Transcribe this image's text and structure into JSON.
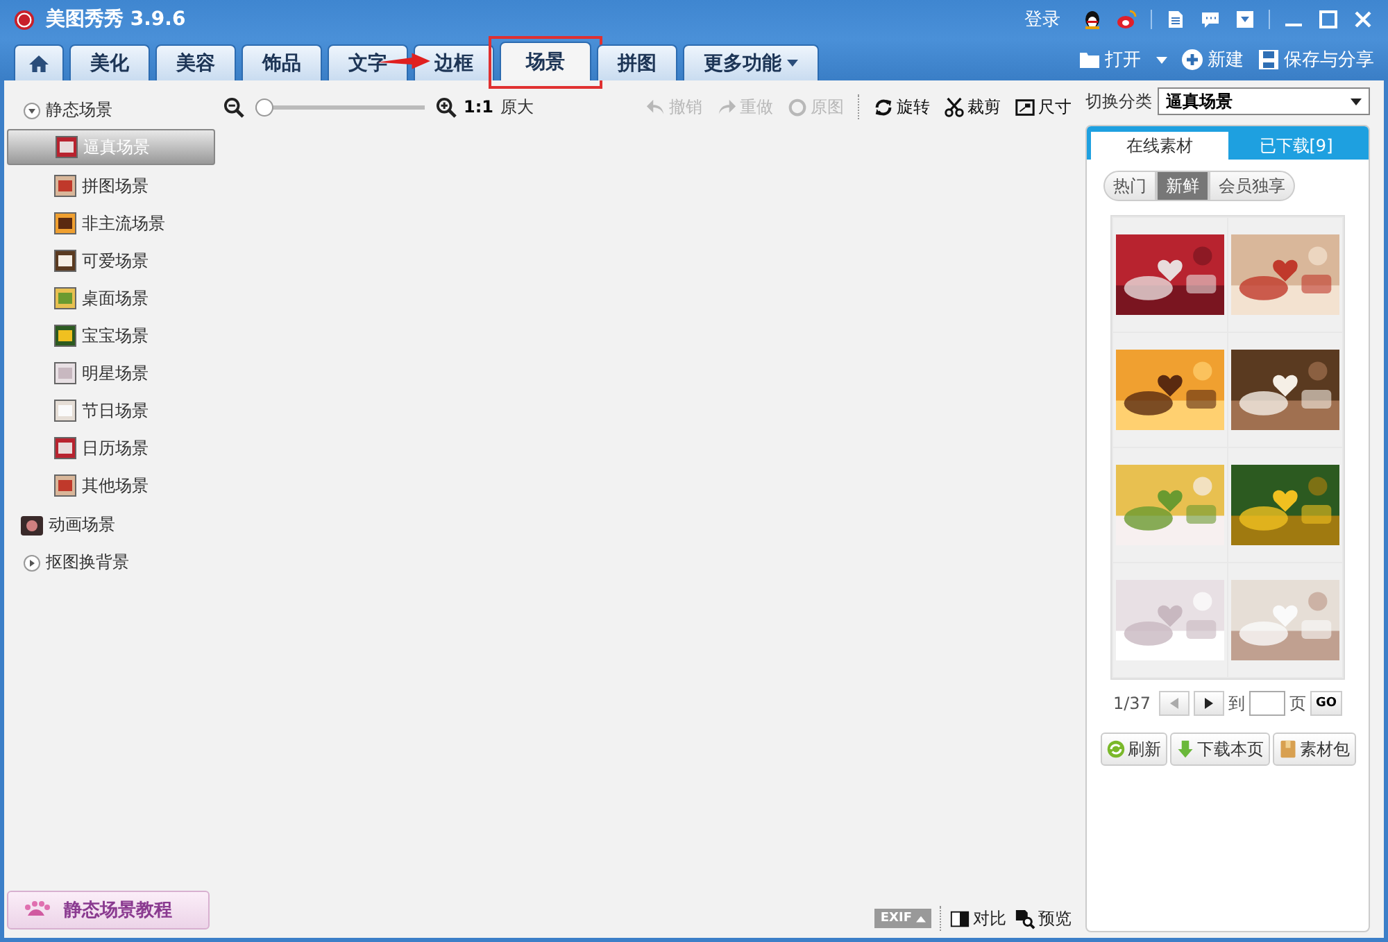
{
  "window": {
    "title": "美图秀秀 3.9.6",
    "login": "登录"
  },
  "tabs": [
    {
      "kind": "home",
      "selected": false
    },
    {
      "kind": "text",
      "label": "美化",
      "selected": false
    },
    {
      "kind": "text",
      "label": "美容",
      "selected": false
    },
    {
      "kind": "text",
      "label": "饰品",
      "selected": false
    },
    {
      "kind": "text",
      "label": "文字",
      "selected": false
    },
    {
      "kind": "text",
      "label": "边框",
      "selected": false,
      "arrow": true
    },
    {
      "kind": "text",
      "label": "场景",
      "selected": true,
      "boxed": true
    },
    {
      "kind": "text",
      "label": "拼图",
      "selected": false
    },
    {
      "kind": "menu",
      "label": "更多功能",
      "selected": false
    }
  ],
  "file_actions": [
    {
      "kind": "open",
      "label": "打开"
    },
    {
      "kind": "new",
      "label": "新建"
    },
    {
      "kind": "save",
      "label": "保存与分享"
    }
  ],
  "sidebar": {
    "items": [
      {
        "kind": "group",
        "label": "静态场景",
        "expanded": true,
        "children": [
          {
            "label": "逼真场景",
            "selected": true
          },
          {
            "label": "拼图场景",
            "selected": false
          },
          {
            "label": "非主流场景",
            "selected": false
          },
          {
            "label": "可爱场景",
            "selected": false
          },
          {
            "label": "桌面场景",
            "selected": false
          },
          {
            "label": "宝宝场景",
            "selected": false
          },
          {
            "label": "明星场景",
            "selected": false
          },
          {
            "label": "节日场景",
            "selected": false
          },
          {
            "label": "日历场景",
            "selected": false
          },
          {
            "label": "其他场景",
            "selected": false
          }
        ]
      },
      {
        "kind": "icon",
        "label": "动画场景"
      },
      {
        "kind": "group",
        "label": "抠图换背景",
        "expanded": false
      }
    ]
  },
  "tutorial_button": "静态场景教程",
  "zoom": {
    "level": 0,
    "ratio": "1:1",
    "label": "原大"
  },
  "toolbar": [
    {
      "kind": "undo",
      "label": "撤销",
      "disabled": true
    },
    {
      "kind": "redo",
      "label": "重做",
      "disabled": true
    },
    {
      "kind": "original",
      "label": "原图",
      "disabled": true
    },
    {
      "kind": "rotate",
      "label": "旋转",
      "disabled": false
    },
    {
      "kind": "crop",
      "label": "裁剪",
      "disabled": false
    },
    {
      "kind": "size",
      "label": "尺寸",
      "disabled": false
    }
  ],
  "category": {
    "label": "切换分类",
    "value": "逼真场景"
  },
  "panel_tabs": [
    {
      "label": "在线素材",
      "selected": true
    },
    {
      "label": "已下载[9]",
      "selected": false
    }
  ],
  "filters": [
    {
      "label": "热门",
      "selected": false
    },
    {
      "label": "新鲜",
      "selected": true
    },
    {
      "label": "会员独享",
      "selected": false
    }
  ],
  "pagination": {
    "page": "1/37",
    "goto": "到",
    "unit": "页",
    "go": "GO"
  },
  "actions": [
    {
      "kind": "refresh",
      "label": "刷新"
    },
    {
      "kind": "download",
      "label": "下载本页"
    },
    {
      "kind": "package",
      "label": "素材包"
    }
  ],
  "bottom": {
    "exif": "EXIF",
    "compare": "对比",
    "preview": "预览"
  }
}
